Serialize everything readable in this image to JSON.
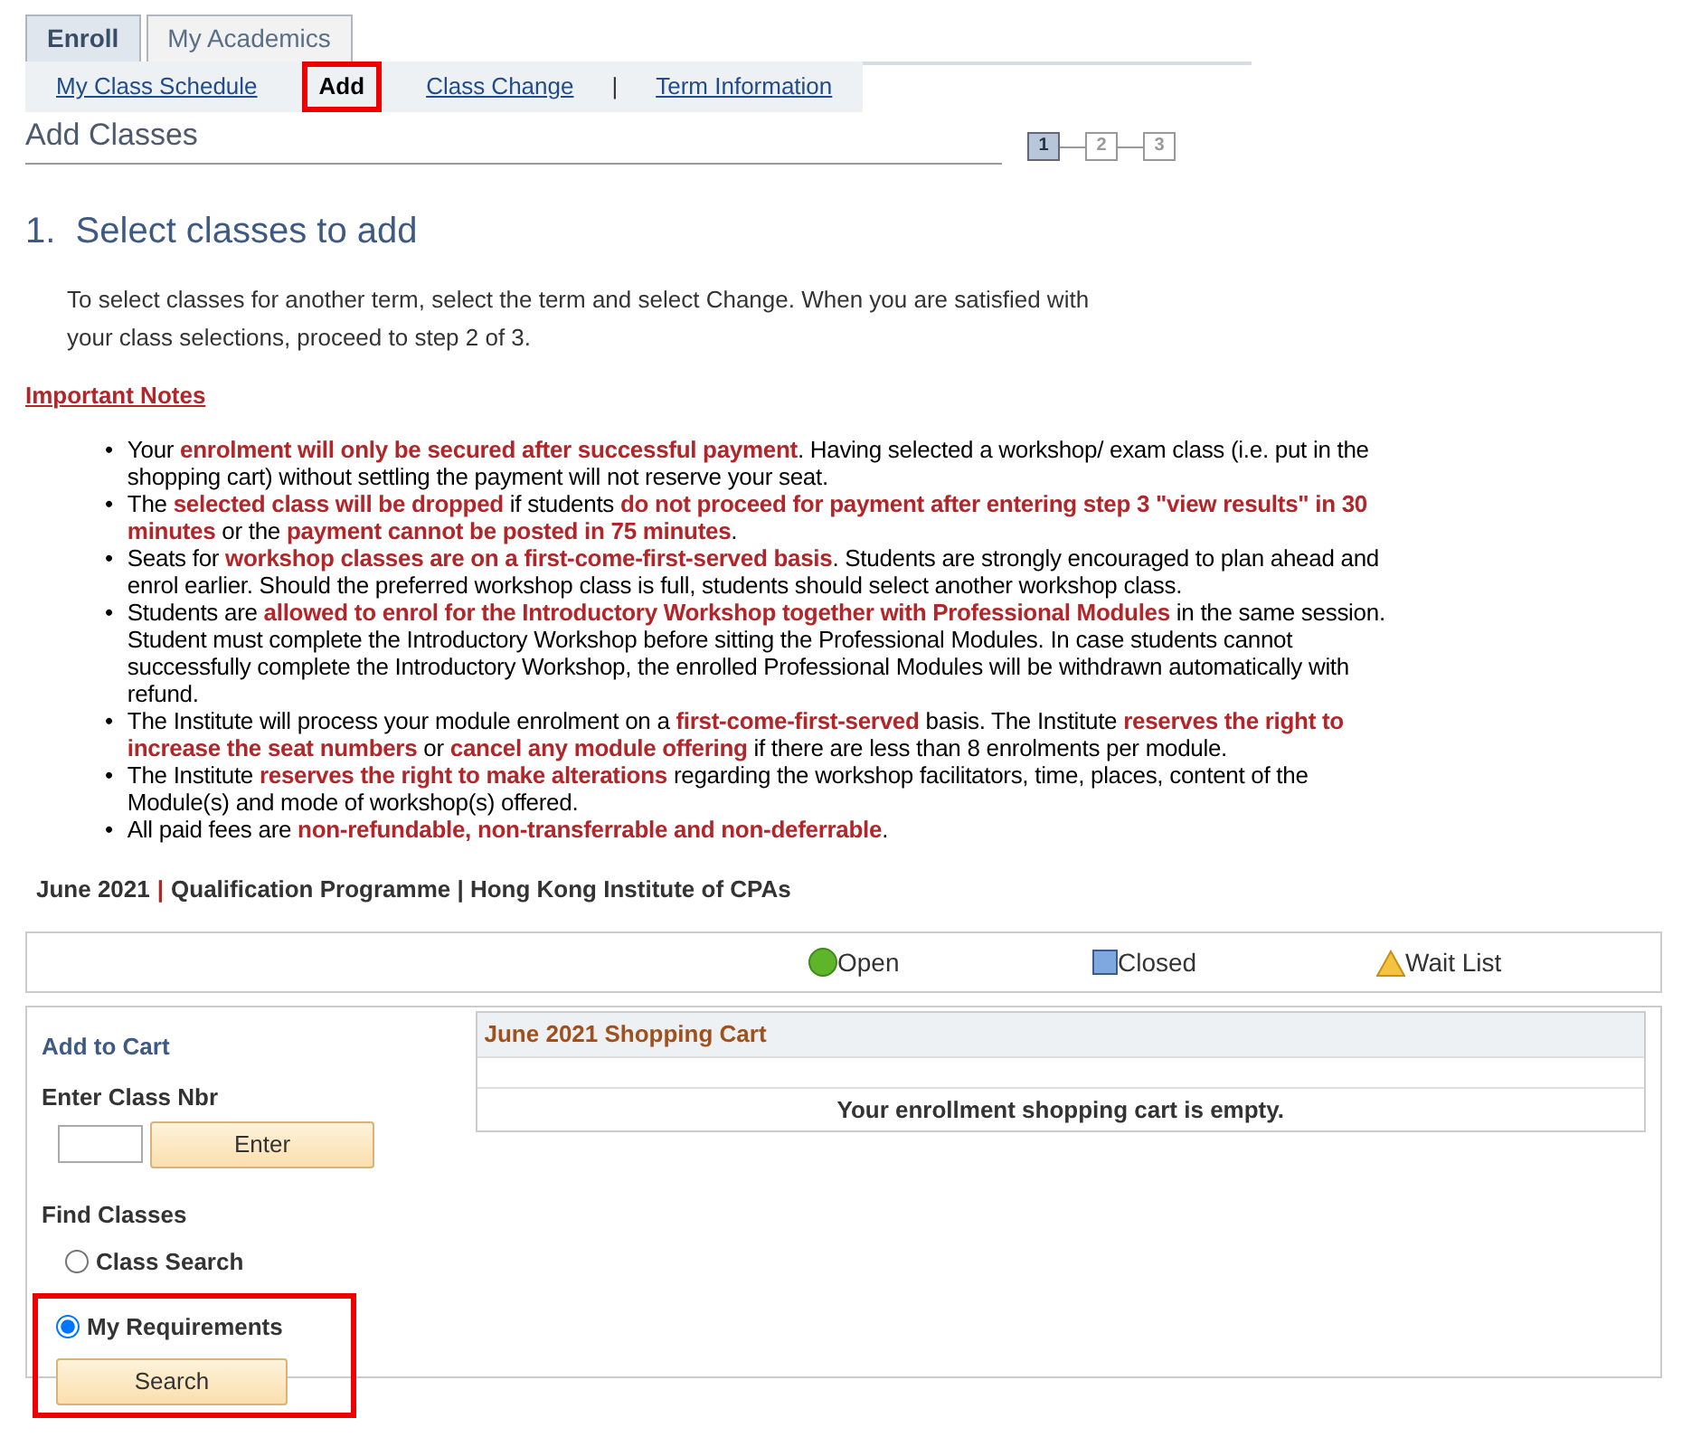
{
  "tabs": [
    {
      "label": "Enroll",
      "selected": true
    },
    {
      "label": "My Academics",
      "selected": false
    }
  ],
  "subnav": [
    {
      "label": "My Class Schedule",
      "selected": false,
      "highlighted": false
    },
    {
      "label": "Add",
      "selected": true,
      "highlighted": true
    },
    {
      "label": "Class Change",
      "selected": false,
      "highlighted": false
    },
    {
      "label": "|",
      "kind": "separator"
    },
    {
      "label": "Term Information",
      "selected": false,
      "highlighted": false
    }
  ],
  "page_title": "Add Classes",
  "steps": [
    {
      "label": "1",
      "selected": true
    },
    {
      "label": "2",
      "selected": false
    },
    {
      "label": "3",
      "selected": false
    }
  ],
  "step_heading": "1.  Select classes to add",
  "instructions": "To select classes for another term, select the term and select Change.  When you are satisfied with your class selections, proceed to step 2 of 3.",
  "notes_title": "Important Notes",
  "note_marker": "•",
  "notes": [
    "Your **enrolment will only be secured after successful payment**.  Having selected a workshop/ exam class (i.e. put in the shopping cart) without settling the payment will not reserve your seat.",
    "The **selected class will be dropped** if students **do not proceed for payment after entering step 3 \"view results\" in 30 minutes** or the **payment cannot be posted in 75 minutes**.",
    "Seats for **workshop classes are on a first-come-first-served basis**.  Students are strongly encouraged to plan ahead and enrol earlier.  Should the preferred workshop class is full, students should select another workshop class.",
    "Students are **allowed to enrol for the Introductory Workshop together with Professional Modules** in the same session.  Student must complete the Introductory Workshop before sitting the Professional Modules.  In case students cannot successfully complete the Introductory Workshop, the enrolled Professional Modules will be withdrawn automatically with refund.",
    "The Institute will process your module enrolment on a **first-come-first-served** basis.  The Institute **reserves the right to increase the seat numbers** or **cancel any module offering** if there are less than 8 enrolments per module.",
    "The Institute **reserves the right to make alterations** regarding the workshop facilitators, time, places, content of the Module(s) and mode of workshop(s) offered.",
    "All paid fees are **non-refundable, non-transferrable and non-deferrable**."
  ],
  "term_line": [
    "June 2021",
    "|",
    "Qualification Programme | Hong Kong Institute of CPAs"
  ],
  "legend": [
    {
      "kind": "open",
      "label": "Open"
    },
    {
      "kind": "closed",
      "label": "Closed"
    },
    {
      "kind": "waitlist",
      "label": "Wait List"
    }
  ],
  "add_to_cart": {
    "title": "Add to Cart",
    "class_nbr_label": "Enter Class Nbr",
    "enter_button": "Enter",
    "find_label": "Find Classes",
    "options": [
      {
        "label": "Class Search",
        "selected": false,
        "highlighted": false
      },
      {
        "label": "My Requirements",
        "selected": true,
        "highlighted": true
      }
    ],
    "search_button": "Search"
  },
  "cart": {
    "title": "June 2021 Shopping Cart",
    "message": "Your enrollment shopping cart is empty."
  }
}
